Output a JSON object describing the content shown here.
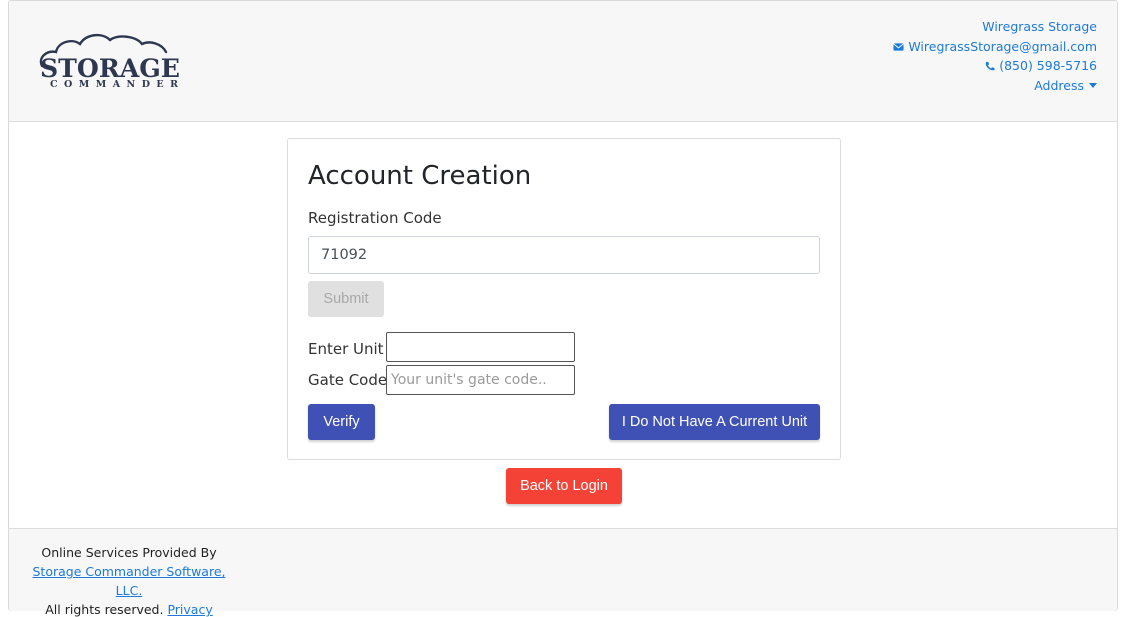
{
  "header": {
    "logo": {
      "name": "storage-commander-logo",
      "word1": "STORAGE",
      "word2": "COMMANDER"
    },
    "contact": {
      "business_name": "Wiregrass Storage",
      "email": "WiregrassStorage@gmail.com",
      "phone": "(850) 598-5716",
      "address_label": "Address",
      "email_icon": "envelope-icon",
      "phone_icon": "phone-icon"
    }
  },
  "card": {
    "title": "Account Creation",
    "registration_code_label": "Registration Code",
    "registration_code_value": "71092",
    "submit_label": "Submit",
    "enter_unit_label": "Enter Unit",
    "enter_unit_value": "",
    "gate_code_label": "Gate Code",
    "gate_code_placeholder": "Your unit's gate code..",
    "verify_label": "Verify",
    "no_unit_label": "I Do Not Have A Current Unit"
  },
  "back_to_login_label": "Back to Login",
  "footer": {
    "provided_by": "Online Services Provided By",
    "company_link": "Storage Commander Software, LLC.",
    "rights": "All rights reserved.",
    "privacy_link": "Privacy Policy"
  },
  "colors": {
    "primary_button": "#3f51b5",
    "danger_button": "#f44336",
    "link": "#1d7ad8",
    "disabled_button": "#e0e0e0"
  }
}
